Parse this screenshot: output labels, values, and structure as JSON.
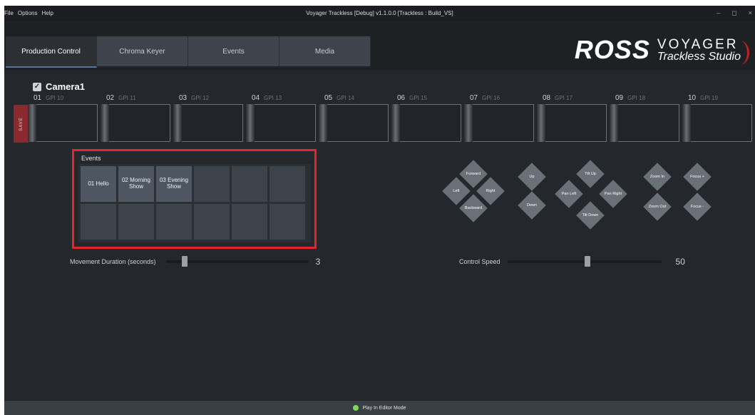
{
  "titlebar": {
    "menu": [
      "File",
      "Options",
      "Help"
    ],
    "title": "Voyager Trackless [Debug] v1.1.0.0 [Trackless : Build_VS]",
    "minimize": "–",
    "maximize": "◻",
    "close": "×"
  },
  "tabs": [
    "Production Control",
    "Chroma Keyer",
    "Events",
    "Media"
  ],
  "logo": {
    "brand": "ROSS",
    "product_line1": "VOYAGER",
    "product_line2": "Trackless Studio",
    "accent": "#c42020"
  },
  "camera": {
    "name": "Camera1",
    "checked": true
  },
  "save_label": "SAVE",
  "presets": [
    {
      "num": "01",
      "gpi": "GPI 10"
    },
    {
      "num": "02",
      "gpi": "GPI 11"
    },
    {
      "num": "03",
      "gpi": "GPI 12"
    },
    {
      "num": "04",
      "gpi": "GPI 13"
    },
    {
      "num": "05",
      "gpi": "GPI 14"
    },
    {
      "num": "06",
      "gpi": "GPI 15"
    },
    {
      "num": "07",
      "gpi": "GPI 16"
    },
    {
      "num": "08",
      "gpi": "GPI 17"
    },
    {
      "num": "09",
      "gpi": "GPI 18"
    },
    {
      "num": "10",
      "gpi": "GPI 19"
    }
  ],
  "events": {
    "label": "Events",
    "items": [
      "01 Hello",
      "02 Morning Show",
      "03 Evening Show",
      "",
      "",
      "",
      "",
      "",
      "",
      "",
      "",
      ""
    ]
  },
  "movement": {
    "label": "Movement Duration (seconds)",
    "value": "3",
    "fraction": 0.11
  },
  "speed": {
    "label": "Control Speed",
    "value": "50",
    "fraction": 0.5
  },
  "controls": {
    "forward": "Forward",
    "backward": "Backward",
    "left": "Left",
    "right": "Right",
    "up": "Up",
    "down": "Down",
    "tilt_up": "Tilt Up",
    "tilt_down": "Tilt Down",
    "pan_left": "Pan Left",
    "pan_right": "Pan Right",
    "zoom_in": "Zoom In",
    "zoom_out": "Zoom Out",
    "focus_plus": "Focus +",
    "focus_minus": "Focus -"
  },
  "status": {
    "text": "Play In Editor Mode",
    "indicator_color": "#7ed957"
  }
}
